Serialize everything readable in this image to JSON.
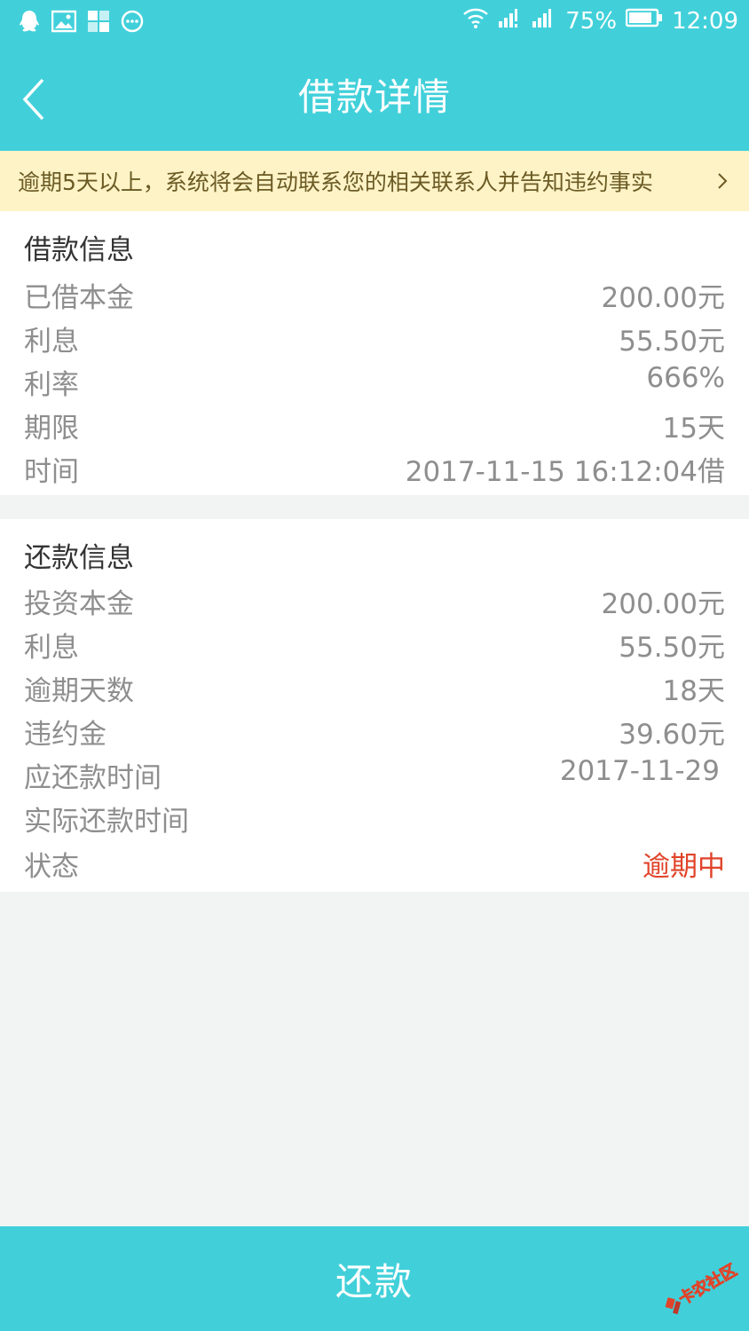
{
  "status_bar": {
    "battery": "75%",
    "time": "12:09"
  },
  "header": {
    "title": "借款详情"
  },
  "notice": {
    "text": "逾期5天以上，系统将会自动联系您的相关联系人并告知违约事实"
  },
  "loan_info": {
    "title": "借款信息",
    "rows": [
      {
        "label": "已借本金",
        "value": "200.00元"
      },
      {
        "label": "利息",
        "value": "55.50元"
      },
      {
        "label": "利率",
        "value": "666%"
      },
      {
        "label": "期限",
        "value": "15天"
      },
      {
        "label": "时间",
        "value": "2017-11-15 16:12:04借"
      }
    ]
  },
  "repay_info": {
    "title": "还款信息",
    "rows": [
      {
        "label": "投资本金",
        "value": "200.00元"
      },
      {
        "label": "利息",
        "value": "55.50元"
      },
      {
        "label": "逾期天数",
        "value": "18天"
      },
      {
        "label": "违约金",
        "value": "39.60元"
      },
      {
        "label": "应还款时间",
        "value": "2017-11-29"
      },
      {
        "label": "实际还款时间",
        "value": ""
      },
      {
        "label": "状态",
        "value": "逾期中"
      }
    ]
  },
  "button": {
    "label": "还款"
  },
  "watermark": {
    "text": "卡农社区"
  },
  "colors": {
    "primary": "#41d0da",
    "notice_bg": "#fdf3c6",
    "status_overdue": "#e0442a"
  }
}
